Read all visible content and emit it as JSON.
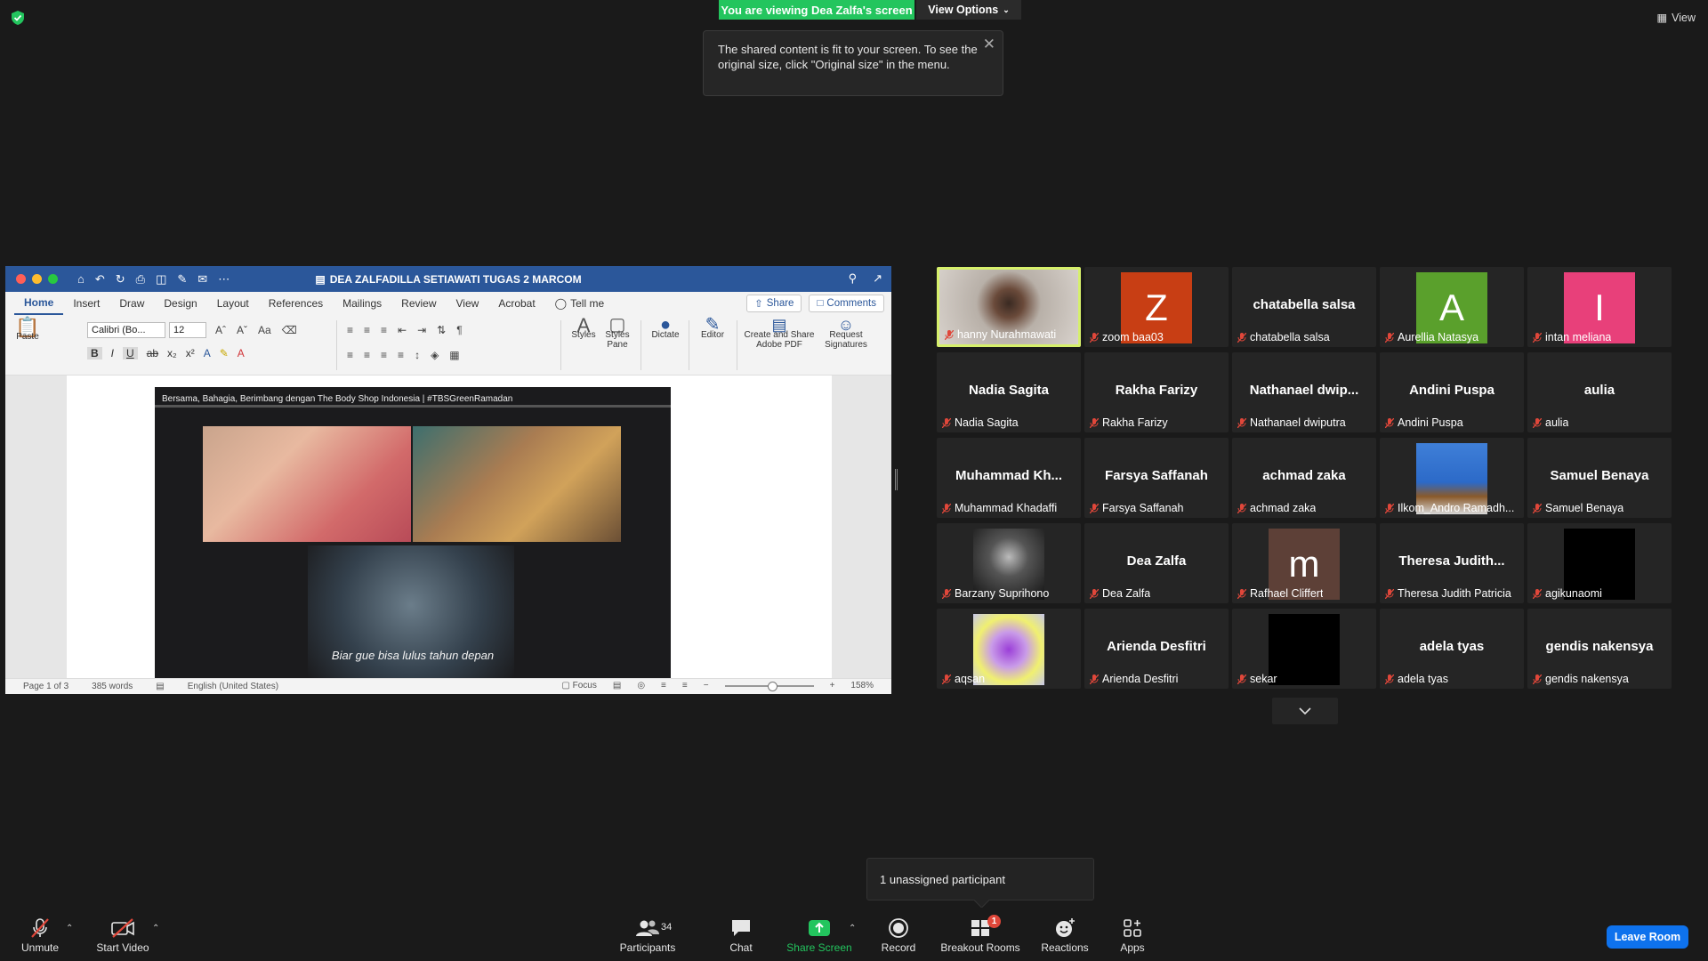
{
  "top": {
    "share_banner": "You are viewing Dea Zalfa's screen",
    "view_options": "View Options",
    "view_label": "View",
    "tooltip": "The shared content is fit to your screen. To see the original size, click \"Original size\" in the menu."
  },
  "word": {
    "doc_title": "DEA ZALFADILLA SETIAWATI TUGAS 2 MARCOM",
    "tabs": [
      "Home",
      "Insert",
      "Draw",
      "Design",
      "Layout",
      "References",
      "Mailings",
      "Review",
      "View",
      "Acrobat",
      "Tell me"
    ],
    "share_label": "Share",
    "comments_label": "Comments",
    "paste_label": "Paste",
    "font_name": "Calibri (Bo...",
    "font_size": "12",
    "styles_label": "Styles",
    "styles_pane_label": "Styles Pane",
    "dictate_label": "Dictate",
    "editor_label": "Editor",
    "create_share_pdf_label": "Create and Share Adobe PDF",
    "request_signatures_label": "Request Signatures",
    "video_title": "Bersama, Bahagia, Berimbang dengan The Body Shop Indonesia | #TBSGreenRamadan",
    "video_subtitle": "Biar gue bisa lulus tahun depan",
    "status": {
      "page": "Page 1 of 3",
      "words": "385 words",
      "language": "English (United States)",
      "focus": "Focus",
      "zoom": "158%"
    }
  },
  "participants": [
    {
      "name": "hanny Nurahmawati",
      "center": "",
      "avatar": "photo-woman",
      "active": true
    },
    {
      "name": "zoom baa03",
      "center": "",
      "avatar_letter": "Z",
      "avatar_color": "#c83e14"
    },
    {
      "name": "chatabella salsa",
      "center": "chatabella salsa"
    },
    {
      "name": "Aurellia Natasya",
      "center": "",
      "avatar_letter": "A",
      "avatar_color": "#5aa02c"
    },
    {
      "name": "intan meliana",
      "center": "",
      "avatar_letter": "I",
      "avatar_color": "#e8407a"
    },
    {
      "name": "Nadia Sagita",
      "center": "Nadia Sagita"
    },
    {
      "name": "Rakha Farizy",
      "center": "Rakha Farizy"
    },
    {
      "name": "Nathanael dwiputra",
      "center": "Nathanael  dwip..."
    },
    {
      "name": "Andini Puspa",
      "center": "Andini Puspa"
    },
    {
      "name": "aulia",
      "center": "aulia"
    },
    {
      "name": "Muhammad Khadaffi",
      "center": "Muhammad  Kh..."
    },
    {
      "name": "Farsya Saffanah",
      "center": "Farsya Saffanah"
    },
    {
      "name": "achmad zaka",
      "center": "achmad zaka"
    },
    {
      "name": "Ilkom_Andro Ramadh...",
      "center": "",
      "avatar": "photo-dog"
    },
    {
      "name": "Samuel Benaya",
      "center": "Samuel Benaya"
    },
    {
      "name": "Barzany Suprihono",
      "center": "",
      "avatar": "photo-bw"
    },
    {
      "name": "Dea Zalfa",
      "center": "Dea Zalfa"
    },
    {
      "name": "Rafhael Cliffert",
      "center": "",
      "avatar_letter": "m",
      "avatar_color": "#5d4037"
    },
    {
      "name": "Theresa Judith Patricia",
      "center": "Theresa  Judith..."
    },
    {
      "name": "agikunaomi",
      "center": "",
      "avatar": "black"
    },
    {
      "name": "aqsan",
      "center": "",
      "avatar": "heart"
    },
    {
      "name": "Arienda Desfitri",
      "center": "Arienda Desfitri"
    },
    {
      "name": "sekar",
      "center": "",
      "avatar": "black"
    },
    {
      "name": "adela tyas",
      "center": "adela tyas"
    },
    {
      "name": "gendis nakensya",
      "center": "gendis nakensya"
    }
  ],
  "unassigned": "1 unassigned participant",
  "toolbar": {
    "unmute": "Unmute",
    "start_video": "Start Video",
    "participants": "Participants",
    "participants_count": "34",
    "chat": "Chat",
    "share_screen": "Share Screen",
    "record": "Record",
    "breakout_rooms": "Breakout Rooms",
    "breakout_badge": "1",
    "reactions": "Reactions",
    "apps": "Apps",
    "leave_room": "Leave Room"
  },
  "colors": {
    "share_green": "#23c55e",
    "word_blue": "#2b579a",
    "leave_blue": "#0e72ed",
    "active_border": "#d6f06b",
    "mic_red": "#e0473a"
  }
}
